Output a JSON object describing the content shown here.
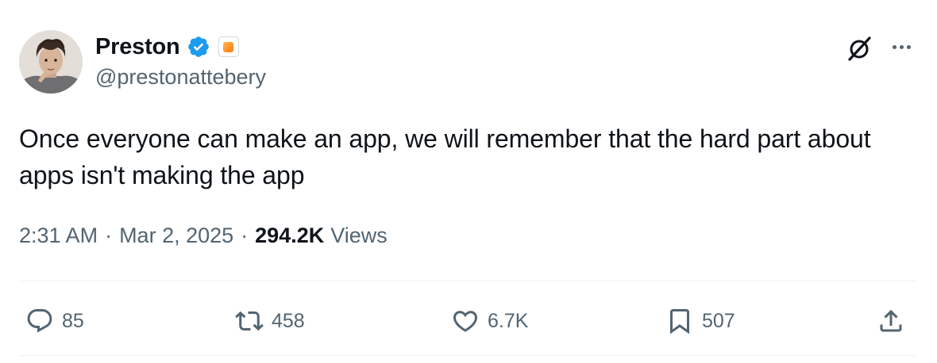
{
  "author": {
    "display_name": "Preston",
    "handle": "@prestonattebery",
    "verified": true,
    "affiliation_badge_color": "#ff8a1f",
    "verified_color": "#1d9bf0"
  },
  "tweet": {
    "text": "Once everyone can make an app, we will remember that the hard part about apps isn't making the app",
    "time": "2:31 AM",
    "date": "Mar 2, 2025",
    "separator": "·",
    "views_count": "294.2K",
    "views_label": "Views"
  },
  "actions": {
    "replies": "85",
    "reposts": "458",
    "likes": "6.7K",
    "bookmarks": "507"
  },
  "icons": {
    "header_right": [
      "grok-icon",
      "more-icon"
    ],
    "actions": [
      "reply-icon",
      "retweet-icon",
      "like-icon",
      "bookmark-icon",
      "share-icon"
    ]
  },
  "colors": {
    "text_primary": "#0f1419",
    "text_secondary": "#536471",
    "divider": "#eff3f4"
  }
}
